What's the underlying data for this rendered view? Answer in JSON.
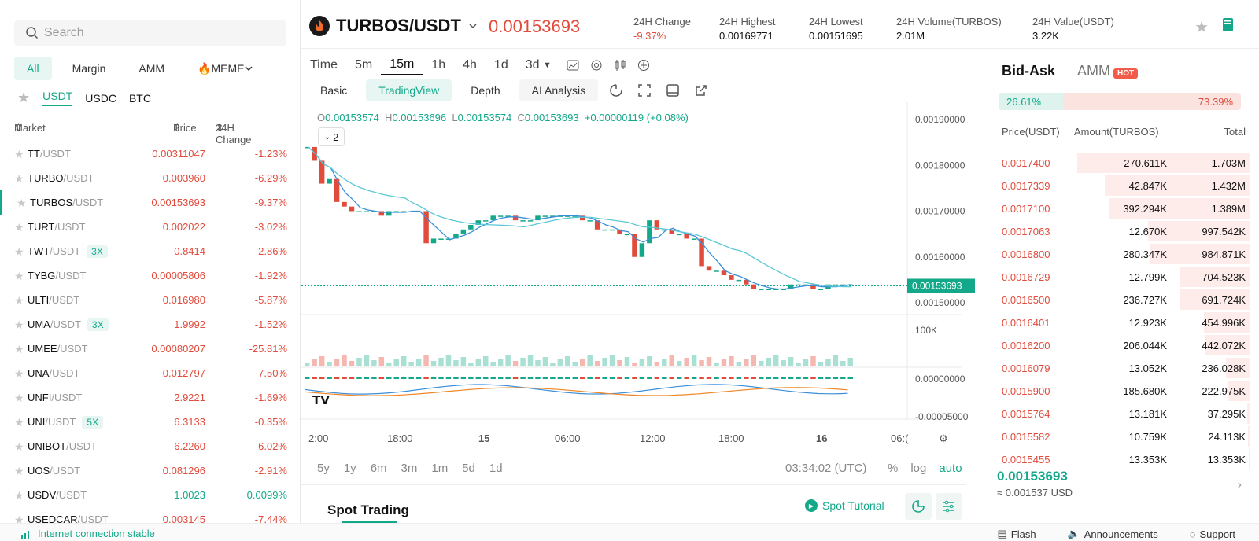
{
  "search": {
    "placeholder": "Search"
  },
  "market_tabs": [
    "All",
    "Margin",
    "AMM",
    "🔥MEME"
  ],
  "quote_tabs": [
    "USDT",
    "USDC",
    "BTC"
  ],
  "market_header": {
    "market": "Market",
    "price": "Price",
    "change": "24H Change"
  },
  "markets": [
    {
      "base": "TT",
      "quote": "/USDT",
      "lev": "",
      "price": "0.00311047",
      "change": "-1.23%",
      "dir": "red"
    },
    {
      "base": "TURBO",
      "quote": "/USDT",
      "lev": "",
      "price": "0.003960",
      "change": "-6.29%",
      "dir": "red"
    },
    {
      "base": "TURBOS",
      "quote": "/USDT",
      "lev": "",
      "price": "0.00153693",
      "change": "-9.37%",
      "dir": "red",
      "selected": true
    },
    {
      "base": "TURT",
      "quote": "/USDT",
      "lev": "",
      "price": "0.002022",
      "change": "-3.02%",
      "dir": "red"
    },
    {
      "base": "TWT",
      "quote": "/USDT",
      "lev": "3X",
      "price": "0.8414",
      "change": "-2.86%",
      "dir": "red"
    },
    {
      "base": "TYBG",
      "quote": "/USDT",
      "lev": "",
      "price": "0.00005806",
      "change": "-1.92%",
      "dir": "red"
    },
    {
      "base": "ULTI",
      "quote": "/USDT",
      "lev": "",
      "price": "0.016980",
      "change": "-5.87%",
      "dir": "red"
    },
    {
      "base": "UMA",
      "quote": "/USDT",
      "lev": "3X",
      "price": "1.9992",
      "change": "-1.52%",
      "dir": "red"
    },
    {
      "base": "UMEE",
      "quote": "/USDT",
      "lev": "",
      "price": "0.00080207",
      "change": "-25.81%",
      "dir": "red"
    },
    {
      "base": "UNA",
      "quote": "/USDT",
      "lev": "",
      "price": "0.012797",
      "change": "-7.50%",
      "dir": "red"
    },
    {
      "base": "UNFI",
      "quote": "/USDT",
      "lev": "",
      "price": "2.9221",
      "change": "-1.69%",
      "dir": "red"
    },
    {
      "base": "UNI",
      "quote": "/USDT",
      "lev": "5X",
      "price": "6.3133",
      "change": "-0.35%",
      "dir": "red"
    },
    {
      "base": "UNIBOT",
      "quote": "/USDT",
      "lev": "",
      "price": "6.2260",
      "change": "-6.02%",
      "dir": "red"
    },
    {
      "base": "UOS",
      "quote": "/USDT",
      "lev": "",
      "price": "0.081296",
      "change": "-2.91%",
      "dir": "red"
    },
    {
      "base": "USDV",
      "quote": "/USDT",
      "lev": "",
      "price": "1.0023",
      "change": "0.0099%",
      "dir": "green"
    },
    {
      "base": "USEDCAR",
      "quote": "/USDT",
      "lev": "",
      "price": "0.003145",
      "change": "-7.44%",
      "dir": "red"
    }
  ],
  "ticker": {
    "pair": "TURBOS/USDT",
    "last": "0.00153693",
    "stats": [
      {
        "label": "24H Change",
        "value": "-9.37%"
      },
      {
        "label": "24H Highest",
        "value": "0.00169771"
      },
      {
        "label": "24H Lowest",
        "value": "0.00151695"
      },
      {
        "label": "24H Volume(TURBOS)",
        "value": "2.01M"
      },
      {
        "label": "24H Value(USDT)",
        "value": "3.22K"
      }
    ]
  },
  "timeframes": [
    "Time",
    "5m",
    "15m",
    "1h",
    "4h",
    "1d",
    "3d"
  ],
  "views": [
    "Basic",
    "TradingView",
    "Depth",
    "AI Analysis"
  ],
  "ohlc": {
    "o": "0.00153574",
    "h": "0.00153696",
    "l": "0.00153574",
    "c": "0.00153693",
    "chg": "+0.00000119 (+0.08%)"
  },
  "collapse_count": "2",
  "price_axis": [
    "0.00190000",
    "0.00180000",
    "0.00170000",
    "0.00160000",
    "0.00150000"
  ],
  "price_tag": "0.00153693",
  "volume_axis": "100K",
  "macd_axis": [
    "0.00000000",
    "-0.00005000"
  ],
  "time_axis": [
    "2:00",
    "18:00",
    "15",
    "06:00",
    "12:00",
    "18:00",
    "16",
    "06:("
  ],
  "ranges": [
    "5y",
    "1y",
    "6m",
    "3m",
    "1m",
    "5d",
    "1d"
  ],
  "clock": "03:34:02 (UTC)",
  "scale_btns": [
    "%",
    "log",
    "auto"
  ],
  "spot": {
    "title": "Spot Trading",
    "tutorial": "Spot Tutorial"
  },
  "book": {
    "tabs": [
      "Bid-Ask",
      "AMM"
    ],
    "hot": "HOT",
    "bid_pct": "26.61%",
    "ask_pct": "73.39%",
    "bid_fraction": 0.2661,
    "headers": {
      "price": "Price(USDT)",
      "amount": "Amount(TURBOS)",
      "total": "Total"
    },
    "asks": [
      {
        "price": "0.0017400",
        "amount": "270.611K",
        "total": "1.703M",
        "depth": 1.0
      },
      {
        "price": "0.0017339",
        "amount": "42.847K",
        "total": "1.432M",
        "depth": 0.84
      },
      {
        "price": "0.0017100",
        "amount": "392.294K",
        "total": "1.389M",
        "depth": 0.82
      },
      {
        "price": "0.0017063",
        "amount": "12.670K",
        "total": "997.542K",
        "depth": 0.59
      },
      {
        "price": "0.0016800",
        "amount": "280.347K",
        "total": "984.871K",
        "depth": 0.58
      },
      {
        "price": "0.0016729",
        "amount": "12.799K",
        "total": "704.523K",
        "depth": 0.41
      },
      {
        "price": "0.0016500",
        "amount": "236.727K",
        "total": "691.724K",
        "depth": 0.41
      },
      {
        "price": "0.0016401",
        "amount": "12.923K",
        "total": "454.996K",
        "depth": 0.27
      },
      {
        "price": "0.0016200",
        "amount": "206.044K",
        "total": "442.072K",
        "depth": 0.26
      },
      {
        "price": "0.0016079",
        "amount": "13.052K",
        "total": "236.028K",
        "depth": 0.14
      },
      {
        "price": "0.0015900",
        "amount": "185.680K",
        "total": "222.975K",
        "depth": 0.13
      },
      {
        "price": "0.0015764",
        "amount": "13.181K",
        "total": "37.295K",
        "depth": 0.02
      },
      {
        "price": "0.0015582",
        "amount": "10.759K",
        "total": "24.113K",
        "depth": 0.014
      },
      {
        "price": "0.0015455",
        "amount": "13.353K",
        "total": "13.353K",
        "depth": 0.008
      }
    ],
    "last_price": "0.00153693",
    "last_usd": "≈ 0.001537 USD"
  },
  "status": {
    "connection": "Internet connection stable",
    "links": [
      "Flash",
      "Announcements",
      "Support"
    ]
  },
  "colors": {
    "accent": "#13a889",
    "down": "#e04b3c",
    "ma1": "#3a8fd9",
    "ma2": "#5bc8d6",
    "macd_signal": "#f0882a"
  }
}
